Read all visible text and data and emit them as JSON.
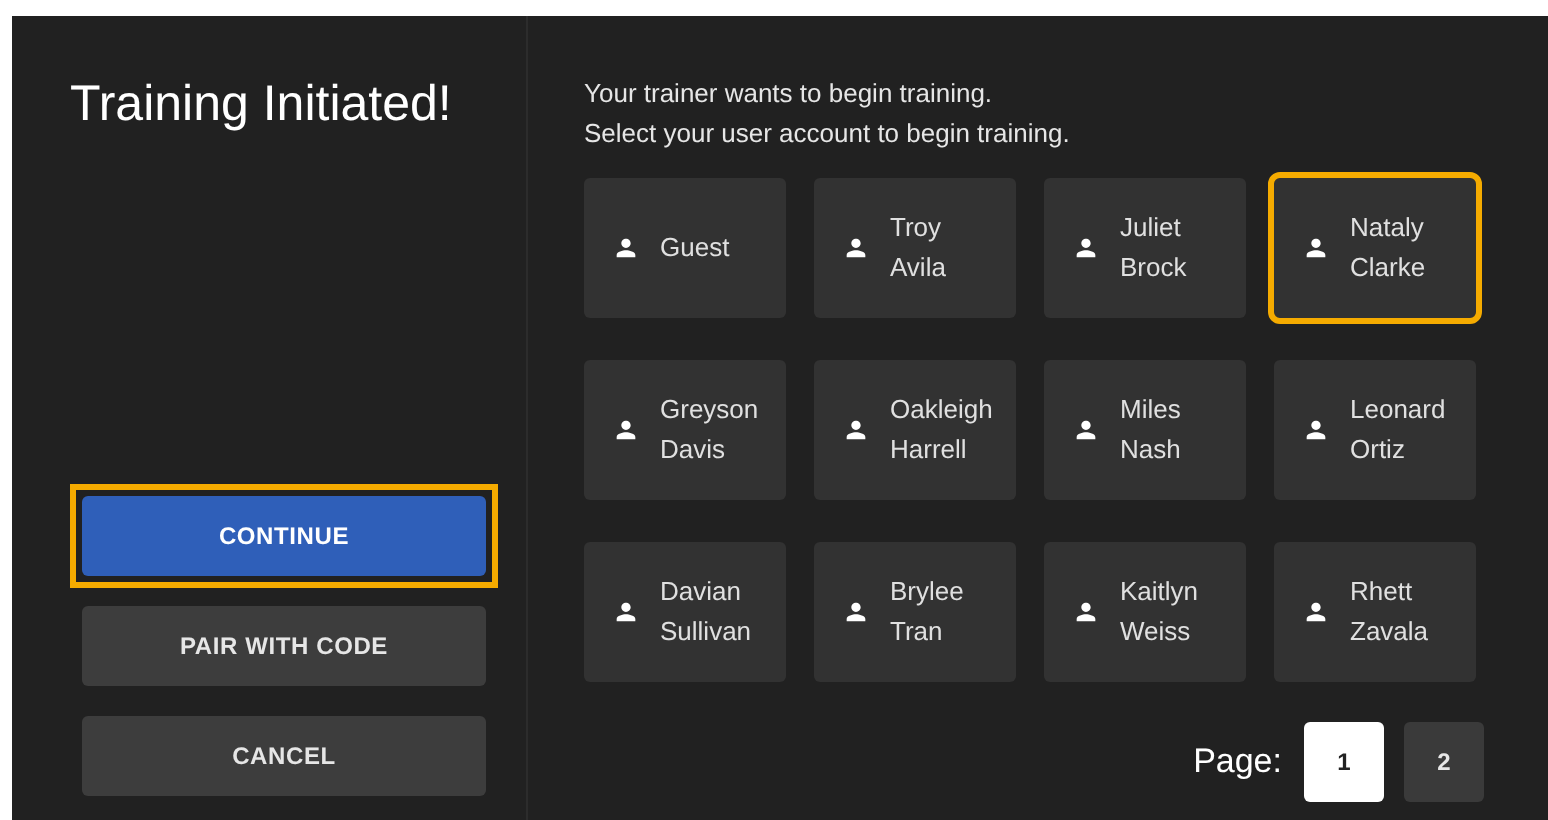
{
  "title": "Training Initiated!",
  "buttons": [
    {
      "label": "CONTINUE",
      "kind": "primary",
      "focused": true
    },
    {
      "label": "PAIR WITH CODE",
      "kind": "secondary",
      "focused": false
    },
    {
      "label": "CANCEL",
      "kind": "secondary",
      "focused": false
    }
  ],
  "instructions": "Your trainer wants to begin training.\nSelect your user account to begin training.",
  "users": [
    {
      "name": "Guest",
      "focused": false
    },
    {
      "name": "Troy\nAvila",
      "focused": false
    },
    {
      "name": "Juliet\nBrock",
      "focused": false
    },
    {
      "name": "Nataly\nClarke",
      "focused": true
    },
    {
      "name": "Greyson\nDavis",
      "focused": false
    },
    {
      "name": "Oakleigh\nHarrell",
      "focused": false
    },
    {
      "name": "Miles\nNash",
      "focused": false
    },
    {
      "name": "Leonard\nOrtiz",
      "focused": false
    },
    {
      "name": "Davian\nSullivan",
      "focused": false
    },
    {
      "name": "Brylee\nTran",
      "focused": false
    },
    {
      "name": "Kaitlyn\nWeiss",
      "focused": false
    },
    {
      "name": "Rhett\nZavala",
      "focused": false
    }
  ],
  "pagination": {
    "label": "Page:",
    "pages": [
      {
        "label": "1",
        "selected": true
      },
      {
        "label": "2",
        "selected": false
      }
    ]
  }
}
